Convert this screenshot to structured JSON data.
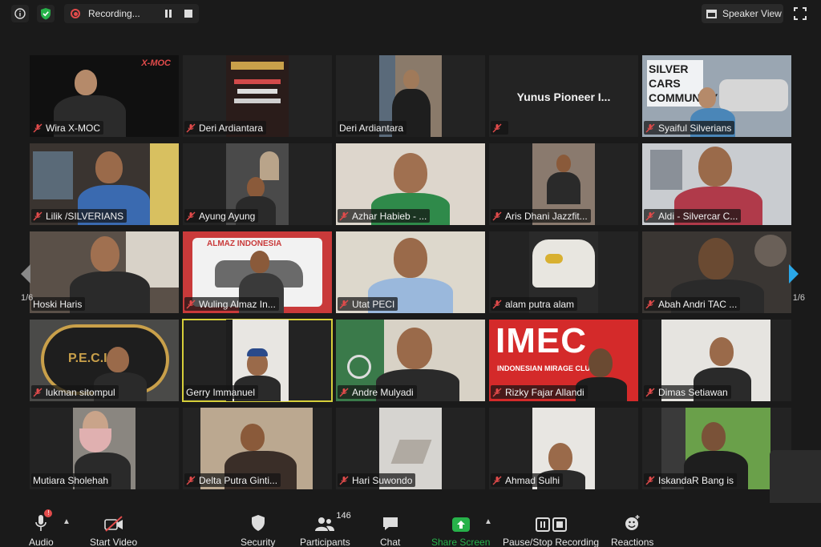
{
  "topbar": {
    "recording_label": "Recording...",
    "speaker_view_label": "Speaker View"
  },
  "pagination": {
    "left": "1/6",
    "right": "1/6"
  },
  "participants": [
    {
      "name": "Wira X-MOC",
      "logo": "X-MOC"
    },
    {
      "name": "Deri Ardiantara"
    },
    {
      "name": "Deri Ardiantara"
    },
    {
      "name": "Yunus Pioneer I...",
      "display_name": "Yunus Pioneer I..."
    },
    {
      "name": "Syaiful Silverians",
      "logo": "SILVER CARS COMMUNITY"
    },
    {
      "name": "Lilik /SILVERIANS"
    },
    {
      "name": "Ayung Ayung"
    },
    {
      "name": "Azhar Habieb - ..."
    },
    {
      "name": "Aris Dhani Jazzfit..."
    },
    {
      "name": "Aldi - Silvercar C..."
    },
    {
      "name": "Hoski Haris"
    },
    {
      "name": "Wuling Almaz In...",
      "logo": "ALMAZ INDONESIA"
    },
    {
      "name": "Utat PECI"
    },
    {
      "name": "alam putra alam"
    },
    {
      "name": "Abah Andri TAC ..."
    },
    {
      "name": "lukman sitompul",
      "logo": "P.E.C.I."
    },
    {
      "name": "Gerry Immanuel"
    },
    {
      "name": "Andre Mulyadi"
    },
    {
      "name": "Rizky Fajar Allandi",
      "logo": "IMEC",
      "logo_sub": "INDONESIAN MIRAGE CLUB"
    },
    {
      "name": "Dimas Setiawan"
    },
    {
      "name": "Mutiara Sholehah"
    },
    {
      "name": "Delta Putra Ginti..."
    },
    {
      "name": "Hari Suwondo"
    },
    {
      "name": "Ahmad Sulhi"
    },
    {
      "name": "IskandaR Bang is"
    }
  ],
  "toolbar": {
    "audio": "Audio",
    "start_video": "Start Video",
    "security": "Security",
    "participants": "Participants",
    "participants_count": "146",
    "chat": "Chat",
    "share_screen": "Share Screen",
    "pause_stop_recording": "Pause/Stop Recording",
    "reactions": "Reactions",
    "audio_badge": "!"
  },
  "colors": {
    "background": "#1a1a1a",
    "tile": "#232323",
    "active_speaker": "#d6cf3a",
    "share_green": "#27b24a",
    "muted_red": "#e24b4b",
    "nav_blue": "#2aa7e8"
  }
}
